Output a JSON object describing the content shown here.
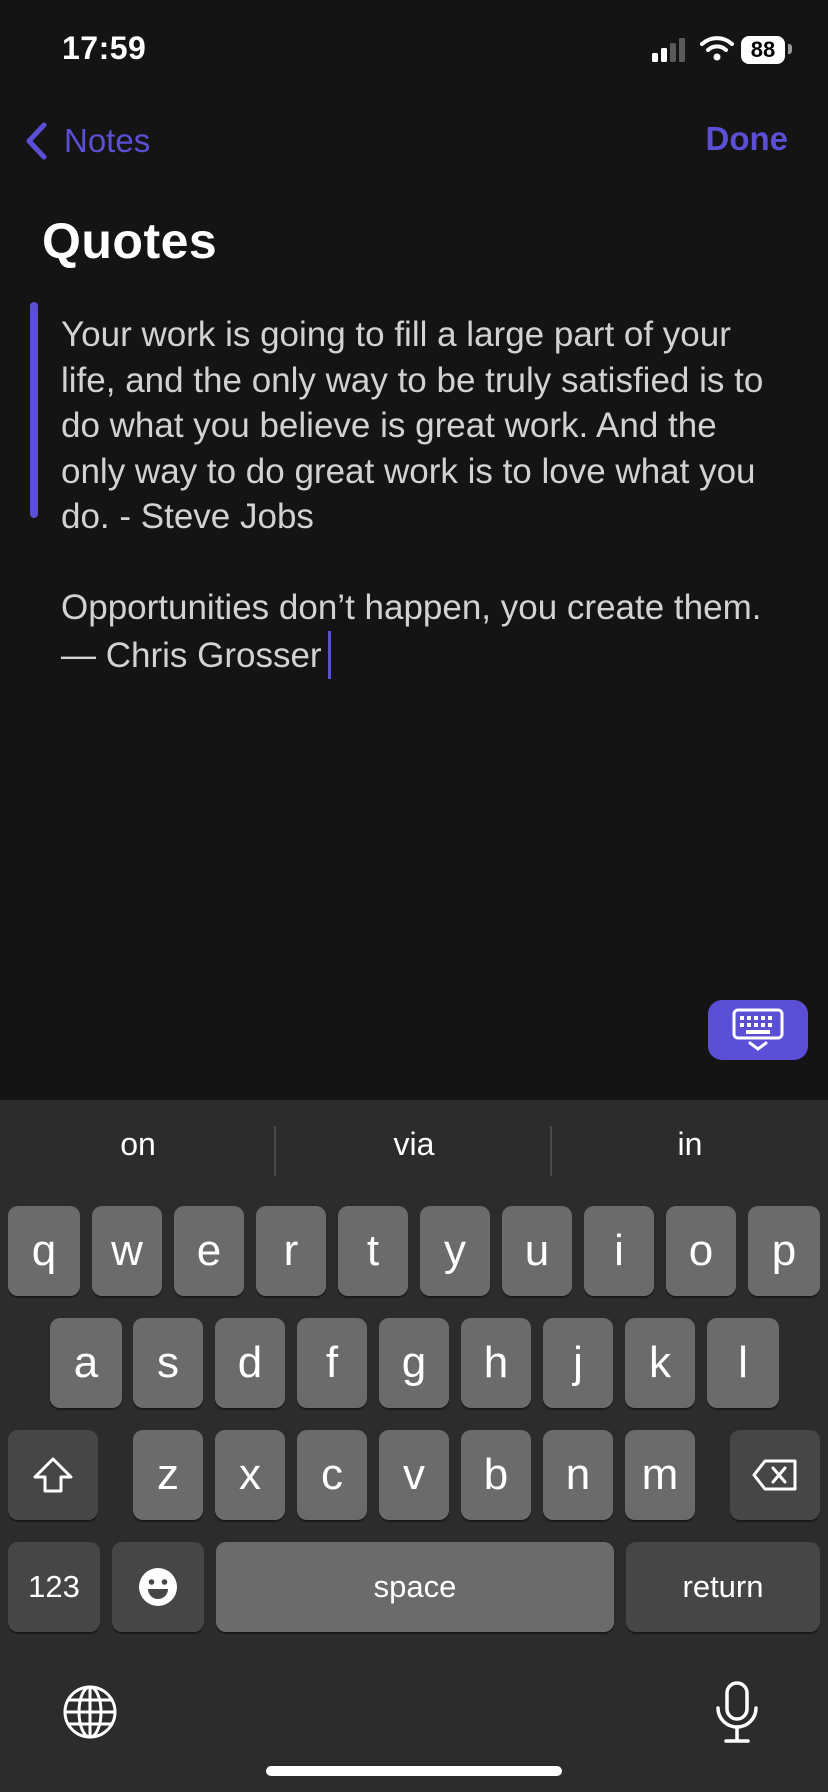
{
  "status_bar": {
    "time": "17:59",
    "battery": "88"
  },
  "nav": {
    "back_label": "Notes",
    "done_label": "Done"
  },
  "note": {
    "title": "Quotes",
    "paragraphs": [
      "Your work is going to fill a large part of your life, and the only way to be truly satisfied is to do what you believe is great work. And the only way to do great work is to love what you do. - Steve Jobs",
      "Opportunities don’t happen, you create them. — Chris Grosser"
    ]
  },
  "keyboard": {
    "suggestions": [
      "on",
      "via",
      "in"
    ],
    "row1": [
      "q",
      "w",
      "e",
      "r",
      "t",
      "y",
      "u",
      "i",
      "o",
      "p"
    ],
    "row2": [
      "a",
      "s",
      "d",
      "f",
      "g",
      "h",
      "j",
      "k",
      "l"
    ],
    "row3": [
      "z",
      "x",
      "c",
      "v",
      "b",
      "n",
      "m"
    ],
    "numbers_label": "123",
    "space_label": "space",
    "return_label": "return"
  },
  "colors": {
    "accent": "#5b4fd6",
    "background": "#141414",
    "keyboard_bg": "#2c2c2c"
  }
}
